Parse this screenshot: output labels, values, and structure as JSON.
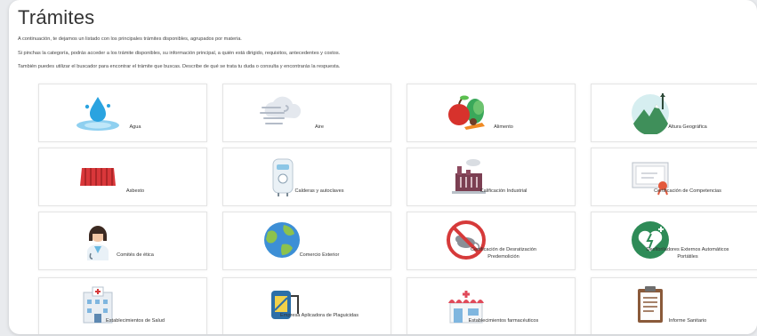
{
  "title": "Trámites",
  "intro": [
    "A continuación, te dejamos un listado con los principales trámites disponibles, agrupados por materia.",
    "Si pinchas la categoría, podrás acceder a los trámite disponibles, su información principal, a quién está dirigido, requisitos, antecedentes y costos.",
    "También puedes utilizar el buscador para encontrar el trámite que buscas. Describe de qué se trata tu duda o consulta y encontrarás la respuesta."
  ],
  "cards": [
    {
      "label": "Agua",
      "icon": "water-drop-icon"
    },
    {
      "label": "Aire",
      "icon": "air-wind-icon"
    },
    {
      "label": "Alimento",
      "icon": "food-icon"
    },
    {
      "label": "Altura Geográfica",
      "icon": "mountain-icon"
    },
    {
      "label": "Asbesto",
      "icon": "roof-tile-icon"
    },
    {
      "label": "Calderas y autoclaves",
      "icon": "boiler-icon"
    },
    {
      "label": "Calificación Industrial",
      "icon": "factory-icon"
    },
    {
      "label": "Certificación de Competencias",
      "icon": "certificate-icon"
    },
    {
      "label": "Comités de ética",
      "icon": "doctor-icon"
    },
    {
      "label": "Comercio Exterior",
      "icon": "globe-icon"
    },
    {
      "label": "Certificación de Desratización Predemolición",
      "icon": "no-rats-icon"
    },
    {
      "label": "Desfibriladores Externos Automáticos Portátiles",
      "icon": "defibrillator-icon"
    },
    {
      "label": "Establecimientos de Salud",
      "icon": "hospital-icon"
    },
    {
      "label": "Empresa Aplicadora de Plaguicidas",
      "icon": "pesticide-sprayer-icon"
    },
    {
      "label": "Establecimientos farmacéuticos",
      "icon": "pharmacy-icon"
    },
    {
      "label": "Informe Sanitario",
      "icon": "clipboard-report-icon"
    }
  ]
}
